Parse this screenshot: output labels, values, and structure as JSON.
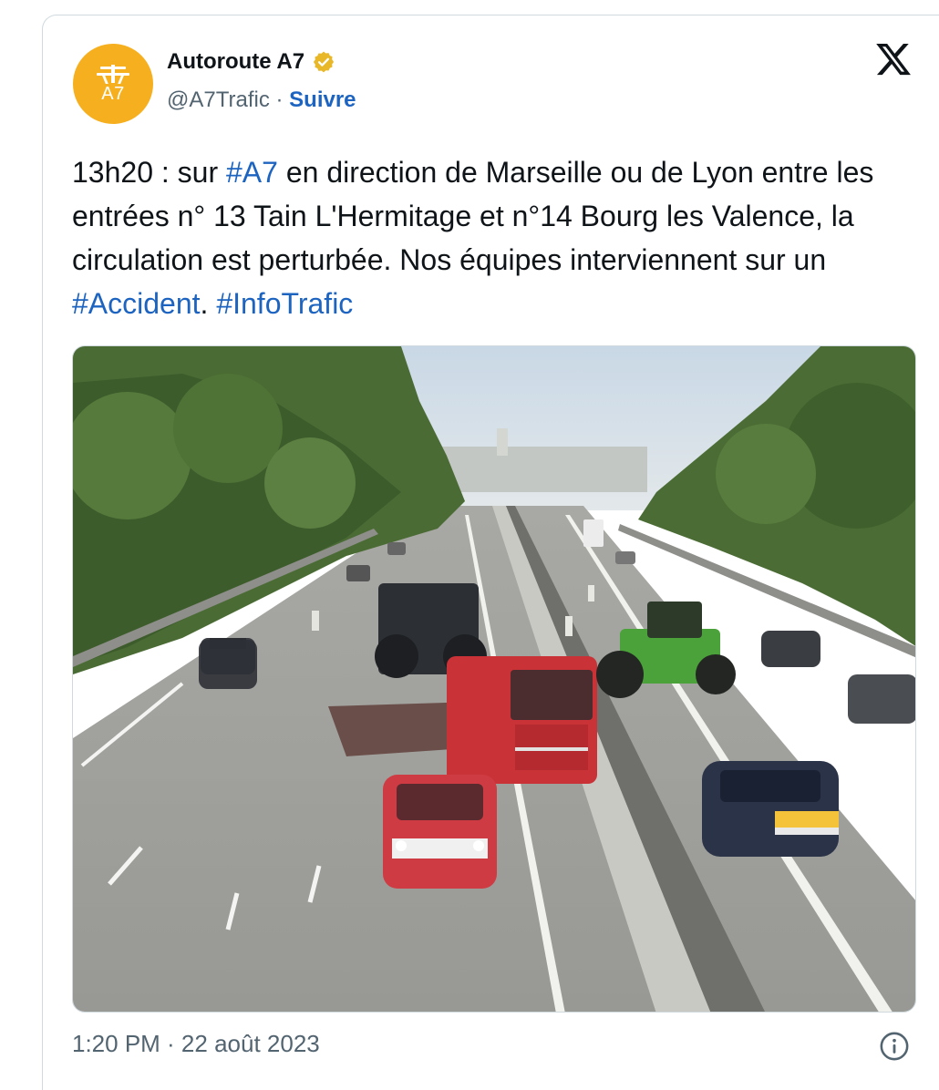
{
  "account": {
    "display_name": "Autoroute A7",
    "handle": "@A7Trafic",
    "separator": " · ",
    "follow_label": "Suivre",
    "avatar_text": "A7",
    "avatar_color": "#f6b01f",
    "verified_badge": "gold-verified-icon"
  },
  "tweet": {
    "segments": [
      {
        "text": "13h20 : sur ",
        "link": false
      },
      {
        "text": "#A7",
        "link": true
      },
      {
        "text": " en direction de Marseille ou de Lyon entre les entrées n° 13 Tain L'Hermitage et n°14 Bourg les Valence, la circulation est perturbée. Nos équipes interviennent sur un ",
        "link": false
      },
      {
        "text": "#Accident",
        "link": true
      },
      {
        "text": ". ",
        "link": false
      },
      {
        "text": "#InfoTrafic",
        "link": true
      }
    ],
    "link_color": "#1d64c1",
    "timestamp": "1:20 PM · 22 août 2023"
  },
  "media": {
    "kind": "photo",
    "subject": "highway-accident-photo"
  },
  "icons": {
    "brand": "x-logo-icon",
    "info": "info-icon"
  }
}
